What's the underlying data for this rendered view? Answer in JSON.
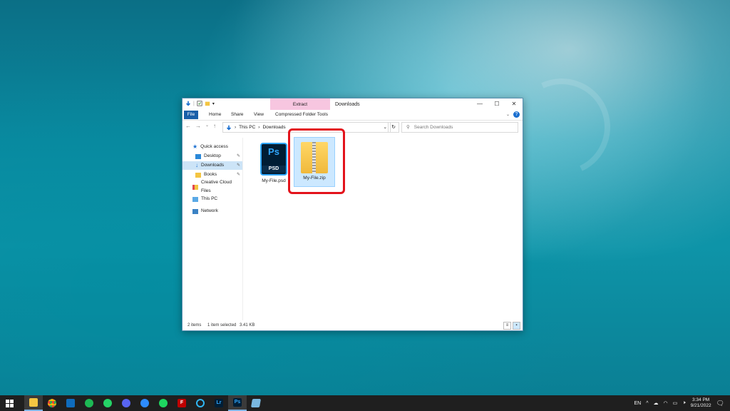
{
  "window": {
    "title": "Downloads",
    "context_tab": "Extract",
    "ribbon_tabs": [
      "File",
      "Home",
      "Share",
      "View",
      "Compressed Folder Tools"
    ],
    "breadcrumb": [
      "This PC",
      "Downloads"
    ],
    "search_placeholder": "Search Downloads"
  },
  "sidebar": {
    "items": [
      {
        "label": "Quick access",
        "icon": "star-icon"
      },
      {
        "label": "Desktop",
        "icon": "desktop-folder-icon",
        "pinned": true
      },
      {
        "label": "Downloads",
        "icon": "download-arrow-icon",
        "pinned": true,
        "selected": true
      },
      {
        "label": "Books",
        "icon": "folder-icon",
        "pinned": true
      },
      {
        "label": "Creative Cloud Files",
        "icon": "creative-cloud-icon"
      },
      {
        "label": "This PC",
        "icon": "computer-icon"
      },
      {
        "label": "Network",
        "icon": "network-icon"
      }
    ]
  },
  "files": [
    {
      "name": "My-File.psd",
      "icon": "photoshop-icon",
      "selected": false
    },
    {
      "name": "My-File.zip",
      "icon": "zip-folder-icon",
      "selected": true
    }
  ],
  "status": {
    "item_count": "2 items",
    "selection": "1 item selected",
    "size": "3.41 KB"
  },
  "taskbar": {
    "apps": [
      "windows-start",
      "file-explorer",
      "chrome",
      "outlook",
      "spotify",
      "whatsapp",
      "discord",
      "zoom",
      "spotify-alt",
      "filezilla",
      "cortana",
      "lightroom",
      "photoshop",
      "notepad"
    ],
    "lightroom_label": "Lr",
    "photoshop_label": "Ps",
    "filezilla_label": "F",
    "language": "EN",
    "time": "3:34 PM",
    "date": "9/21/2022"
  },
  "colors": {
    "accent": "#1a5fa8",
    "extract_tab": "#f7c6e0",
    "highlight": "#e3131b",
    "selection": "#cce8ff"
  }
}
